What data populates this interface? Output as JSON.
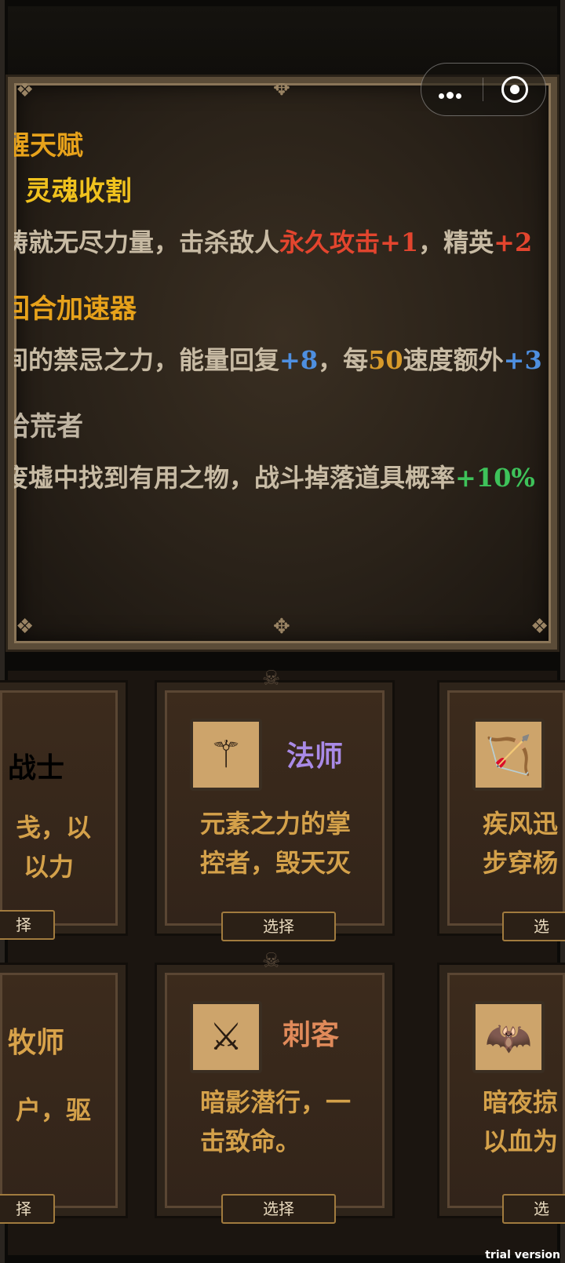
{
  "talents": {
    "t1_title": "觉醒天赋",
    "t1_title_visible": "醒天赋",
    "t2_title": "] 灵魂收割",
    "t2_desc_a": "铸就无尽力量，击杀敌人",
    "t2_desc_b": "永久攻击+1",
    "t2_desc_c": "，精英",
    "t2_desc_d": "+2",
    "t3_title": "回合加速器",
    "t3_desc_a": "间的禁忌之力，能量回复",
    "t3_desc_b": "+8",
    "t3_desc_c": "，每",
    "t3_desc_d": "50",
    "t3_desc_e": "速度额外",
    "t3_desc_f": "+3",
    "t4_title": "拾荒者",
    "t4_desc_a": "废墟中找到有用之物，战斗掉落道具概率",
    "t4_desc_b": "+10%"
  },
  "classes": [
    {
      "name": "战士",
      "desc1": "戋，以",
      "desc2": "以力",
      "button": "择",
      "color": "#d9a34a",
      "icon": "sword-icon"
    },
    {
      "name": "法师",
      "desc1": "元素之力的掌",
      "desc2": "控者，毁天灭",
      "button": "选择",
      "color": "#a98ae6",
      "icon": "staff-icon"
    },
    {
      "name": "",
      "desc1": "疾风迅",
      "desc2": "步穿杨",
      "button": "选",
      "color": "#d9a34a",
      "icon": "bow-icon"
    },
    {
      "name": "牧师",
      "desc1": "户，驱",
      "desc2": "",
      "button": "择",
      "color": "#d9a34a",
      "icon": "cross-icon"
    },
    {
      "name": "刺客",
      "desc1": "暗影潜行，一",
      "desc2": "击致命。",
      "button": "选择",
      "color": "#e08a5a",
      "icon": "hooded-figure-icon"
    },
    {
      "name": "",
      "desc1": "暗夜掠",
      "desc2": "以血为",
      "button": "选",
      "color": "#d9a34a",
      "icon": "bat-icon"
    }
  ],
  "watermark": "trial version",
  "colors": {
    "accent_gold": "#e7a21b",
    "red": "#e3452e",
    "blue": "#4e8fe0",
    "green": "#3ec25a"
  }
}
